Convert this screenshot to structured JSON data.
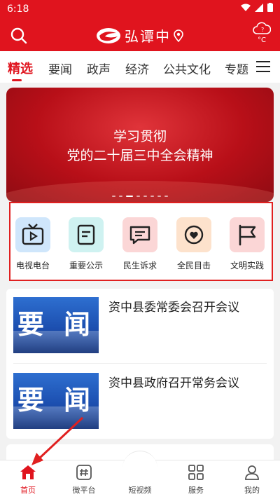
{
  "status": {
    "time": "6:18"
  },
  "header": {
    "app_name": "弘谭中",
    "weather_unit": "°C",
    "weather_value": "?"
  },
  "tabs": [
    {
      "label": "精选",
      "active": true
    },
    {
      "label": "要闻"
    },
    {
      "label": "政声"
    },
    {
      "label": "经济"
    },
    {
      "label": "公共文化"
    },
    {
      "label": "专题"
    }
  ],
  "banner": {
    "line1": "学习贯彻",
    "line2": "党的二十届三中全会精神",
    "active_dot": 2,
    "dot_count": 8
  },
  "shortcuts": [
    {
      "label": "电视电台",
      "icon": "tv-icon",
      "bg": "#cfe6fb"
    },
    {
      "label": "重要公示",
      "icon": "notice-icon",
      "bg": "#cff2f1"
    },
    {
      "label": "民生诉求",
      "icon": "message-icon",
      "bg": "#fbd6d6"
    },
    {
      "label": "全民目击",
      "icon": "eye-icon",
      "bg": "#fde2cc"
    },
    {
      "label": "文明实践",
      "icon": "flag-icon",
      "bg": "#fbd6d6"
    }
  ],
  "news": [
    {
      "title": "资中县委常委会召开会议",
      "thumb_text": [
        "要",
        "闻"
      ]
    },
    {
      "title": "资中县政府召开常务会议",
      "thumb_text": [
        "要",
        "闻"
      ]
    }
  ],
  "bottom_nav": [
    {
      "label": "首页",
      "icon": "home-icon",
      "active": true
    },
    {
      "label": "微平台",
      "icon": "hashtag-icon"
    },
    {
      "label": "短视频",
      "icon": "video-icon"
    },
    {
      "label": "服务",
      "icon": "grid-icon"
    },
    {
      "label": "我的",
      "icon": "user-icon"
    }
  ],
  "colors": {
    "brand": "#e0141e",
    "highlight_border": "#e02020"
  }
}
